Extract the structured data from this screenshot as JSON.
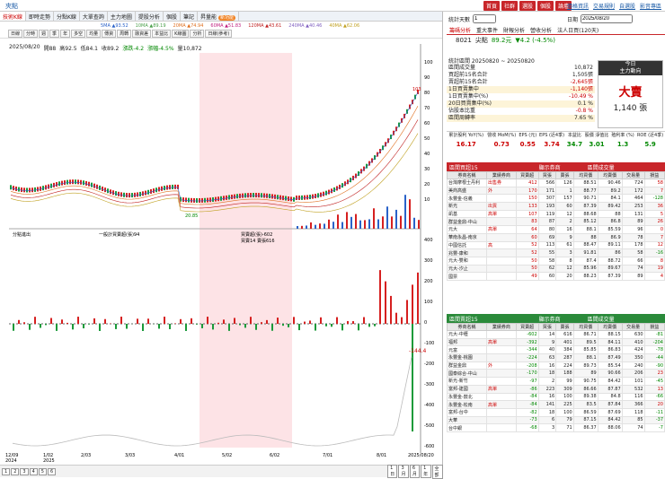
{
  "header": {
    "title": "夾點",
    "nav": [
      "首頁",
      "社群",
      "選股",
      "個股",
      "論壇"
    ],
    "links": [
      "價格資訊",
      "交易規則",
      "自選股",
      "影音專區"
    ]
  },
  "tabs": [
    "技術K線",
    "即時走勢",
    "分點K線",
    "大單查詢",
    "主力地圖",
    "提股分析",
    "個股",
    "筆記",
    "昇量能"
  ],
  "tabs_badge": "新功能",
  "ma": [
    "5MA ▲93.52",
    "10MA ▲89.19",
    "20MA ▲74.94",
    "60MA ▲51.83",
    "120MA ▲43.61",
    "240MA ▲40.46",
    "40MA ▲62.06"
  ],
  "ma_colors": [
    "#2a62c9",
    "#4aa04a",
    "#e07020",
    "#c02080",
    "#c02020",
    "#8060c0",
    "#c0a020"
  ],
  "tools": [
    "日線",
    "分時",
    "週",
    "季",
    "年",
    "多空",
    "均量",
    "傳資",
    "周轉",
    "融資差",
    "本益比",
    "K線圖",
    "分析",
    "日線(參考)"
  ],
  "stock_info": {
    "date": "2025/08/20",
    "open_lbl": "開",
    "open": "88",
    "high_lbl": "高",
    "high": "92.5",
    "low_lbl": "低",
    "low": "84.1",
    "close_lbl": "收",
    "close": "89.2",
    "chg_lbl": "漲跌",
    "chg": "-4.2",
    "pct_lbl": "漲幅",
    "pct": "-4.5%",
    "vol_lbl": "量",
    "vol": "10,872"
  },
  "chart": {
    "price_labels": [
      "100",
      "90",
      "80",
      "70",
      "60",
      "50",
      "40",
      "30",
      "20",
      "10"
    ],
    "max_label": "103",
    "min_label": "20.85",
    "vol_labels": [
      "400",
      "300",
      "200",
      "100",
      "0",
      "-100",
      "-200",
      "-300",
      "-400",
      "-500",
      "-600"
    ],
    "last_val": "-144.4",
    "date_labels": [
      "12/09\n2024",
      "1/02\n2025",
      "2/03",
      "3/03",
      "4/01",
      "5/02",
      "6/02",
      "7/01",
      "8/01",
      "2025/08/20"
    ],
    "lower_legend": "分點進出",
    "lower_sel": "總覽",
    "lower_info1": "一般計買賣超(張)94",
    "lower_info2": "買賣超(張)-602",
    "lower_info3": "買賣14 賣張616"
  },
  "bottom": [
    "1",
    "2",
    "3",
    "4",
    "5",
    "6",
    "1日",
    "3月",
    "6月",
    "1年",
    "全部"
  ],
  "right": {
    "selector": "統計天數",
    "days": "1",
    "date_lbl": "日期",
    "date": "2025/08/20",
    "rtabs": [
      "籌碼分析",
      "重大事件",
      "財報分析",
      "營收分析",
      "法人日買(120天)"
    ],
    "code": "8021",
    "name": "尖點",
    "price": "89.2元",
    "change": "▼4.2 (-4.5%)",
    "period": "統計區間 20250820 ~ 20250820",
    "stats": [
      [
        "區間成交量",
        "10,872"
      ],
      [
        "買超前15名合計",
        "1,505張"
      ],
      [
        "賣超前15名合計",
        "-2,645張"
      ],
      [
        "1日買賣集中",
        "-1,140張"
      ],
      [
        "1日買賣集中(%)",
        "-10.49 %"
      ],
      [
        "20日買賣集中(%)",
        "0.1 %"
      ],
      [
        "佔股本比重",
        "-0.8 %"
      ],
      [
        "區間周轉率",
        "7.65 %"
      ]
    ],
    "today": "今日",
    "today_sub": "主力動向",
    "verdict": "大賣",
    "verdict_amt": "1,140 張",
    "metrics_h": [
      "累計股利\nYoY(%)",
      "營收\nMoM(%)",
      "EPS\n(元)",
      "EPS\n(近4季)",
      "本益比",
      "股價\n淨值比",
      "殖利率\n(%)",
      "ROE\n(近4季)"
    ],
    "metrics_v": [
      "16.17",
      "0.73",
      "0.55",
      "3.74",
      "34.7",
      "3.01",
      "1.3",
      "5.9"
    ],
    "buy_title": "區間買超15",
    "sell_title": "區間賣超15",
    "badge": "顯示券商",
    "scope": "區間成交量",
    "cols": [
      "券商名稱",
      "業績券商",
      "買賣超",
      "買張",
      "賣張",
      "均買價",
      "均賣價",
      "交易量",
      "損益"
    ],
    "buy": [
      [
        "台灣摩根士丹利",
        "出售券",
        "412",
        "566",
        "126",
        "88.51",
        "90.46",
        "724",
        "58"
      ],
      [
        "美商高盛",
        "外",
        "170",
        "171",
        "1",
        "88.77",
        "89.2",
        "172",
        "7"
      ],
      [
        "永豐金-信義",
        "",
        "150",
        "307",
        "157",
        "90.71",
        "84.1",
        "464",
        "-128"
      ],
      [
        "新光",
        "出貨",
        "133",
        "193",
        "60",
        "87.39",
        "89.42",
        "253",
        "36"
      ],
      [
        "凱基",
        "高單",
        "107",
        "119",
        "12",
        "88.68",
        "88",
        "131",
        "5"
      ],
      [
        "群益金鼎-中山",
        "",
        "83",
        "87",
        "2",
        "85.12",
        "86.8",
        "89",
        "26"
      ],
      [
        "元大",
        "高單",
        "64",
        "80",
        "16",
        "88.1",
        "85.59",
        "96",
        "0"
      ],
      [
        "華南永昌-南京",
        "",
        "60",
        "69",
        "9",
        "88",
        "86.9",
        "78",
        "7"
      ],
      [
        "中國信託",
        "高",
        "52",
        "113",
        "61",
        "88.47",
        "89.11",
        "178",
        "12"
      ],
      [
        "兆豐-康和",
        "",
        "52",
        "55",
        "3",
        "91.81",
        "86",
        "58",
        "-16"
      ],
      [
        "元大-雙和",
        "",
        "50",
        "58",
        "8",
        "87.4",
        "88.72",
        "66",
        "8"
      ],
      [
        "元大-汐止",
        "",
        "50",
        "62",
        "12",
        "85.96",
        "89.67",
        "74",
        "19"
      ],
      [
        "國票",
        "",
        "49",
        "60",
        "20",
        "88.23",
        "87.39",
        "89",
        "4"
      ]
    ],
    "sell": [
      [
        "元大-中壢",
        "",
        "-602",
        "14",
        "616",
        "86.71",
        "88.15",
        "630",
        "-81"
      ],
      [
        "福邦",
        "高單",
        "-392",
        "9",
        "401",
        "89.5",
        "84.11",
        "410",
        "-204"
      ],
      [
        "元富",
        "",
        "-344",
        "40",
        "384",
        "85.85",
        "86.83",
        "424",
        "-78"
      ],
      [
        "永豐金-桃園",
        "",
        "-224",
        "63",
        "287",
        "88.1",
        "87.49",
        "350",
        "-44"
      ],
      [
        "群益金鼎",
        "外",
        "-208",
        "16",
        "224",
        "89.73",
        "85.54",
        "240",
        "-90"
      ],
      [
        "國泰綜合-中山",
        "",
        "-170",
        "18",
        "188",
        "89",
        "90.66",
        "206",
        "23"
      ],
      [
        "新光-新竹",
        "",
        "-97",
        "2",
        "99",
        "90.75",
        "84.42",
        "101",
        "-45"
      ],
      [
        "富邦-建國",
        "高單",
        "-86",
        "223",
        "309",
        "86.66",
        "87.87",
        "532",
        "13"
      ],
      [
        "永豐金-鼓北",
        "",
        "-84",
        "16",
        "100",
        "89.38",
        "84.8",
        "116",
        "-66"
      ],
      [
        "永豐金-松南",
        "高單",
        "-84",
        "141",
        "225",
        "83.5",
        "87.84",
        "366",
        "20"
      ],
      [
        "富邦-台中",
        "",
        "-82",
        "18",
        "100",
        "86.59",
        "87.69",
        "118",
        "-11"
      ],
      [
        "大華",
        "",
        "-73",
        "6",
        "79",
        "87.15",
        "84.42",
        "85",
        "-37"
      ],
      [
        "台中銀",
        "",
        "-68",
        "3",
        "71",
        "86.37",
        "88.06",
        "74",
        "-7"
      ]
    ]
  }
}
